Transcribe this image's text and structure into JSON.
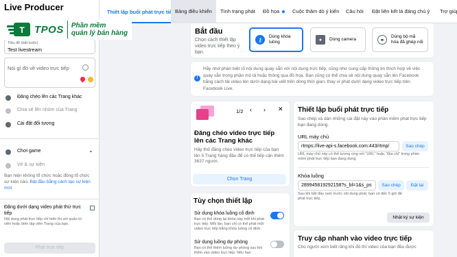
{
  "left_panel": {
    "title": "Live Producer",
    "logo": {
      "word": "TPOS",
      "tagline_1": "Phần mềm",
      "tagline_2": "quản lý bán hàng"
    },
    "title_field": {
      "label": "Tiêu đề (bắt buộc)",
      "value": "Test livestream"
    },
    "description_placeholder": "Nói gì đó về video trực tiếp",
    "crosspost": "Đăng chéo lên các Trang khác",
    "share_group": "Chia sẻ lên nhóm của Trang",
    "audience": "Cài đặt đối tượng",
    "game": "Chơi game",
    "location": "Vé & sự kiện",
    "event_hint": "Bạn hiện không tổ chức hoặc đồng tổ chức sự kiện nào.",
    "event_link": "Bật đầu bằng cách tạo sự kiện mới.",
    "unpublished_title": "Đăng dưới dạng video phát thử trực tiếp",
    "unpublished_desc": "Nội dung phát trực tiếp chỉ hiển thị với quản trị viên hoặc biên tập viên Trang của bạn.",
    "go_live": "Phát trực tiếp"
  },
  "tabs": [
    {
      "label": "Thiết lập buổi phát trực tiếp"
    },
    {
      "label": "Bảng điều khiển"
    },
    {
      "label": "Tình trạng phát"
    },
    {
      "label": "Đồ họa"
    },
    {
      "label": "Cuộc thăm dò ý kiến"
    },
    {
      "label": "Câu hỏi"
    },
    {
      "label": "Đặt liên kết lá đáng chú ý"
    },
    {
      "label": "Trợ giúp"
    }
  ],
  "start": {
    "title": "Bắt đầu",
    "desc": "Chọn cách thiết lập video trực tiếp theo ý bạn.",
    "options": [
      {
        "label": "Dùng khóa luồng",
        "icon": "key-icon"
      },
      {
        "label": "Dùng camera",
        "icon": "camera-icon"
      },
      {
        "label": "Dùng bộ mã hóa đã ghép nối",
        "icon": "link-icon"
      }
    ]
  },
  "notice": "Hãy nhớ phân biệt rõ nội dung quay sẵn với nội dung trực tiếp, cũng như cung cấp thông tin thích hợp về việc quay sẵn trong phần mô tả hoặc thông qua đồ họa. Bạn cũng có thể chia sẻ nội dung quay sẵn lên Facebook bằng cách tải video lên dưới dạng bài viết trên dòng thời gian, thay vì phát dưới dạng video trực tiếp trên Facebook Live.",
  "crosspost_card": {
    "pager": "1/2",
    "title": "Đăng chéo video trực tiếp lên các Trang khác",
    "desc": "Hãy thử đăng chéo video trực tiếp của bạn lên 5 Trang hàng đầu để có thể tiếp cận thêm 3637 người.",
    "button": "Chọn Trang"
  },
  "settings": {
    "title": "Tùy chọn thiết lập",
    "persistent_key": {
      "title": "Sử dụng khóa luồng cố định",
      "desc": "Bạn có thể dùng lại khóa này mỗi khi phát trực tiếp. Mỗi lần, bạn chỉ có thể phát một video trực tiếp bằng khóa luồng cố định.",
      "on": true
    },
    "backup_stream": {
      "title": "Sử dụng luồng dự phòng",
      "desc": "Bạn có thể thêm luồng dự phòng sau khi thêm vào video trực tiếp. Nếu bạn",
      "on": false
    }
  },
  "stream_setup": {
    "title": "Thiết lập buổi phát trực tiếp",
    "desc": "Sao chép và dán những cài đặt này vào phần mềm phát trực tiếp bạn đang dùng.",
    "server_label": "URL máy chủ",
    "server_value": "rtmps://live-api-s.facebook.com:443/rtmp/",
    "server_copy": "Sao chép",
    "server_hint": "URL máy chủ này có thể tương ứng với \"URL\" hoặc \"Địa chỉ\" trong phần mềm phát trực tiếp bạn đang dùng.",
    "key_label": "Khóa luồng",
    "key_value": "289945819292158?s_bl=1&s_ps",
    "key_copy": "Sao chép",
    "key_reset": "Đặt lại",
    "key_hint": "Sau khi bắt đầu xem trước nội dung phát, bạn có đến 5 giờ để phát trực tiếp.",
    "log_button": "Nhật ký sự kiện"
  },
  "quick_access": {
    "title": "Truy cập nhanh vào video trực tiếp",
    "desc": "Cho người xem biết rằng khi đó thì video của bạn đều được"
  },
  "colors": {
    "accent": "#1877f2",
    "brand_green": "#0b7a3b"
  }
}
